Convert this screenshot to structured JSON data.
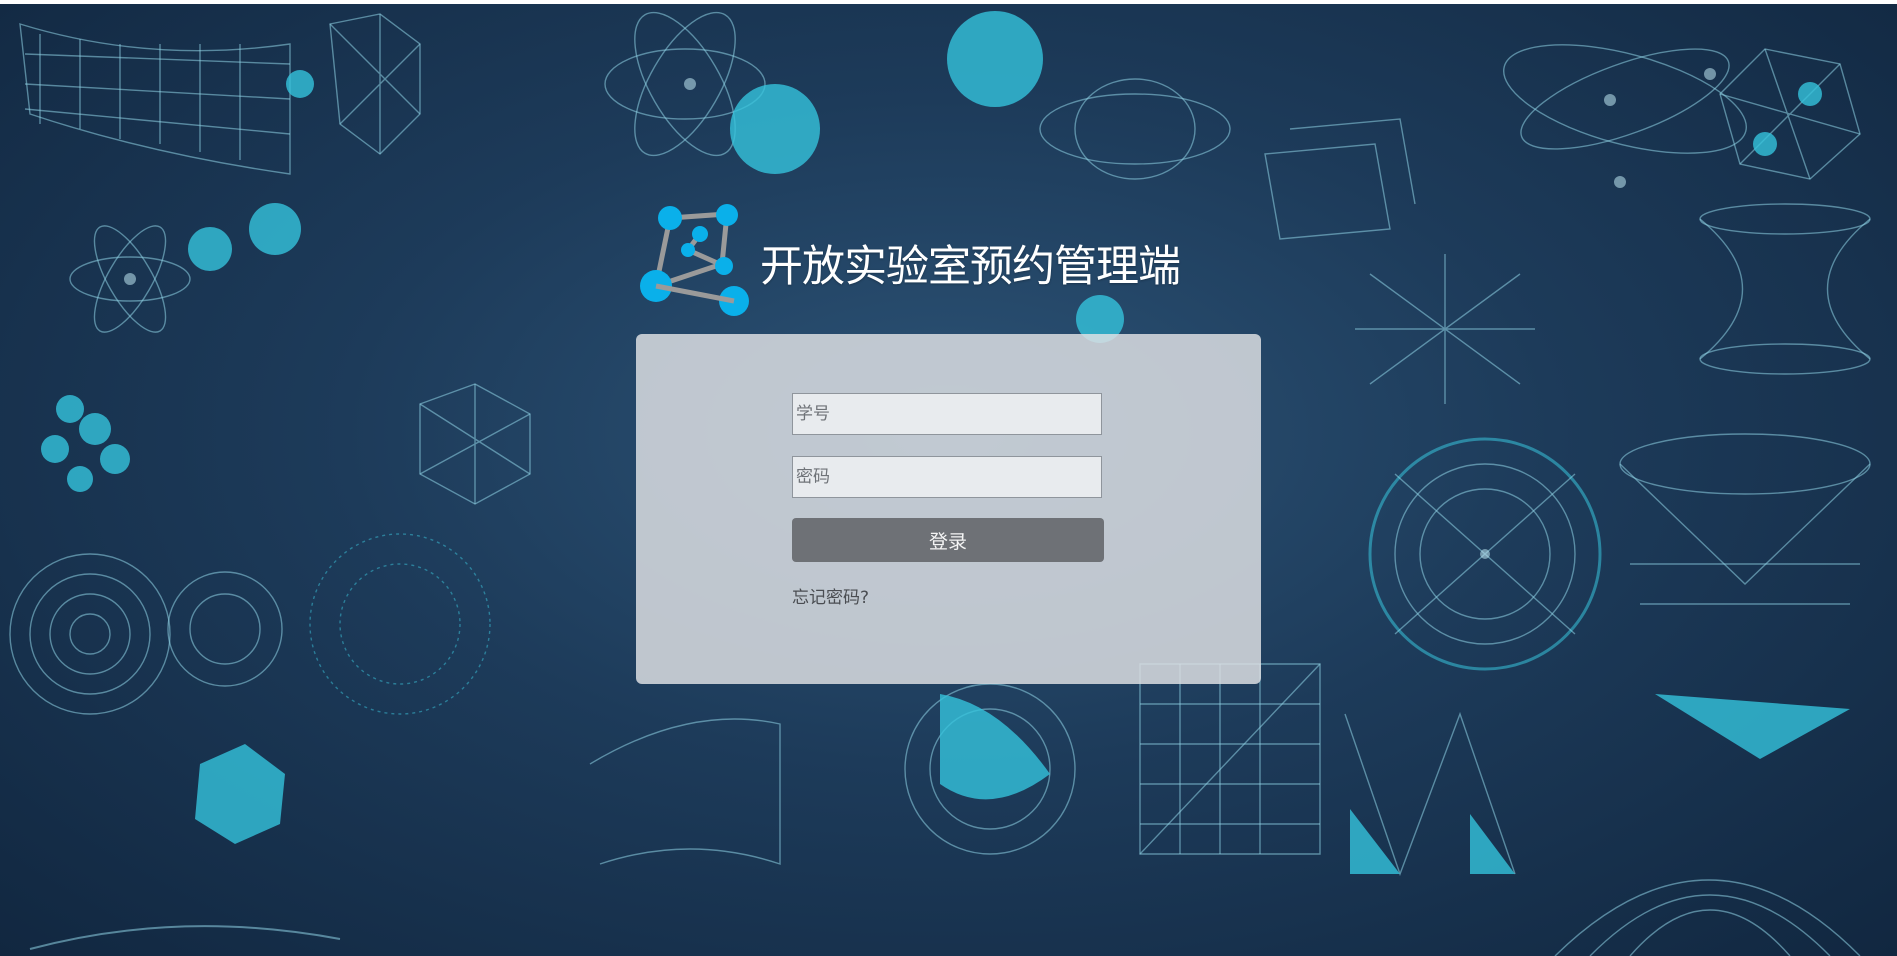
{
  "app": {
    "title": "开放实验室预约管理端"
  },
  "login_form": {
    "username_placeholder": "学号",
    "password_placeholder": "密码",
    "submit_label": "登录",
    "forgot_password_label": "忘记密码?"
  },
  "theme": {
    "accent": "#00aee8",
    "background": "#1b3a5a",
    "panel": "#dee0e4",
    "button": "#6e7176"
  },
  "icons": {
    "brand_logo": "molecule-network-logo-icon"
  }
}
